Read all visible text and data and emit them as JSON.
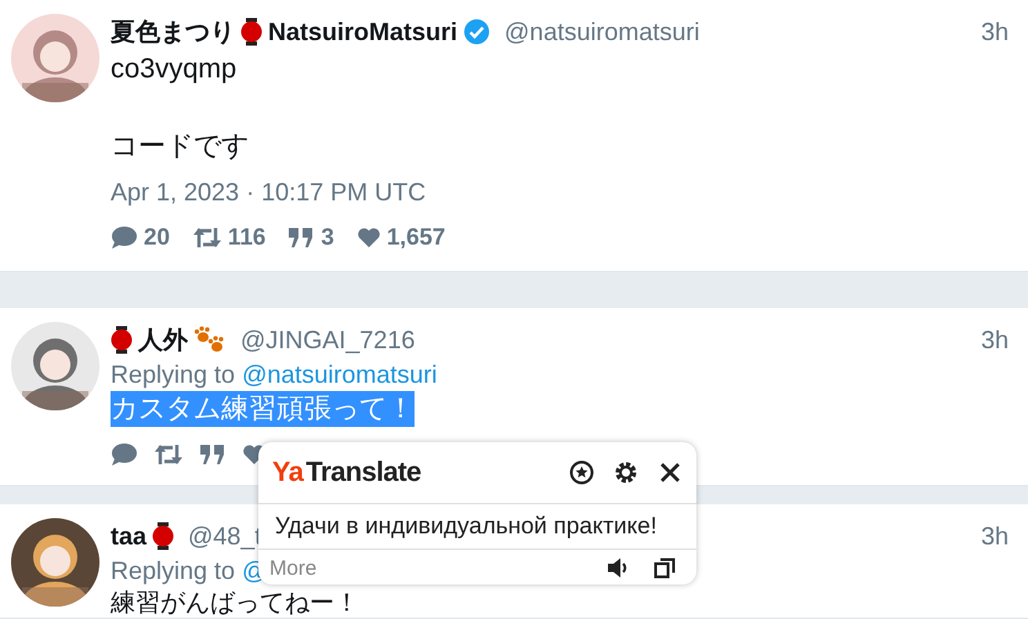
{
  "tweets": [
    {
      "name_parts": [
        {
          "kind": "text",
          "text": "夏色まつり"
        },
        {
          "kind": "lantern"
        },
        {
          "kind": "text",
          "text": "NatsuiroMatsuri"
        }
      ],
      "verified": true,
      "handle": "@natsuiromatsuri",
      "time": "3h",
      "text": [
        "co3vyqmp",
        "コードです"
      ],
      "text_selected": false,
      "date": "Apr 1, 2023 · 10:17 PM UTC",
      "stats": [
        {
          "kind": "reply",
          "count": "20"
        },
        {
          "kind": "retweet",
          "count": "116"
        },
        {
          "kind": "quote",
          "count": "3"
        },
        {
          "kind": "like",
          "count": "1,657"
        }
      ]
    },
    {
      "name_parts": [
        {
          "kind": "lantern"
        },
        {
          "kind": "text",
          "text": "人外"
        },
        {
          "kind": "paws"
        }
      ],
      "verified": false,
      "handle": "@JINGAI_7216",
      "time": "3h",
      "replying_label": "Replying to",
      "replying_to": "@natsuiromatsuri",
      "text": [
        "カスタム練習頑張って！"
      ],
      "text_selected": true,
      "stats": [
        {
          "kind": "reply"
        },
        {
          "kind": "retweet"
        },
        {
          "kind": "quote"
        },
        {
          "kind": "like"
        }
      ]
    },
    {
      "name_parts": [
        {
          "kind": "text",
          "text": "taa"
        },
        {
          "kind": "lantern"
        }
      ],
      "verified": false,
      "handle": "@48_t",
      "time": "3h",
      "replying_label": "Replying to",
      "replying_to": "@",
      "text": [
        "練習がんばってねー！"
      ],
      "text_selected": false
    }
  ],
  "translate_popup": {
    "logo_mark": "Ya",
    "logo_text": "Translate",
    "translation": "Удачи в индивидуальной практике!",
    "more": "More"
  }
}
